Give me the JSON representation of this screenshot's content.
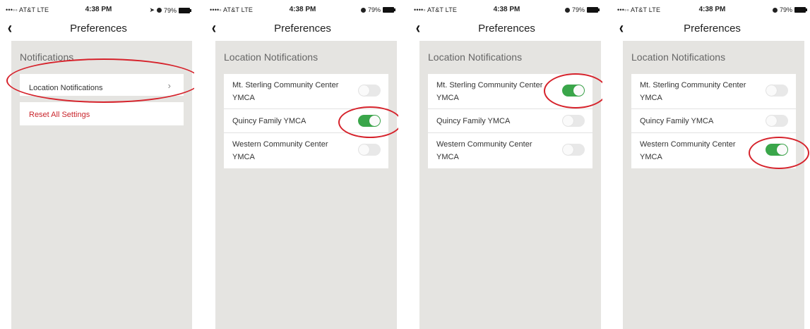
{
  "status": {
    "carrier_1": "•••◦◦ AT&T  LTE",
    "carrier_2": "••••◦ AT&T  LTE",
    "time": "4:38 PM",
    "battery": "79%",
    "location_glyph": "➤"
  },
  "nav": {
    "title": "Preferences",
    "back_glyph": "‹"
  },
  "colors": {
    "toggle_on": "#3aa64a",
    "toggle_off": "#e8e8e8",
    "highlight_ring": "#d6222b",
    "reset_text": "#c9252c",
    "background": "#e5e4e1"
  },
  "screen1": {
    "section": "Notifications",
    "location_item": "Location Notifications",
    "chevron": "›",
    "reset_item": "Reset All Settings"
  },
  "section2": "Location Notifications",
  "locations": {
    "l1a": "Mt. Sterling Community Center",
    "l1b": "YMCA",
    "l2": "Quincy Family YMCA",
    "l3a": "Western Community Center",
    "l3b": "YMCA"
  },
  "screen2_toggles": [
    false,
    true,
    false
  ],
  "screen3_toggles": [
    true,
    false,
    false
  ],
  "screen4_toggles": [
    false,
    false,
    true
  ]
}
